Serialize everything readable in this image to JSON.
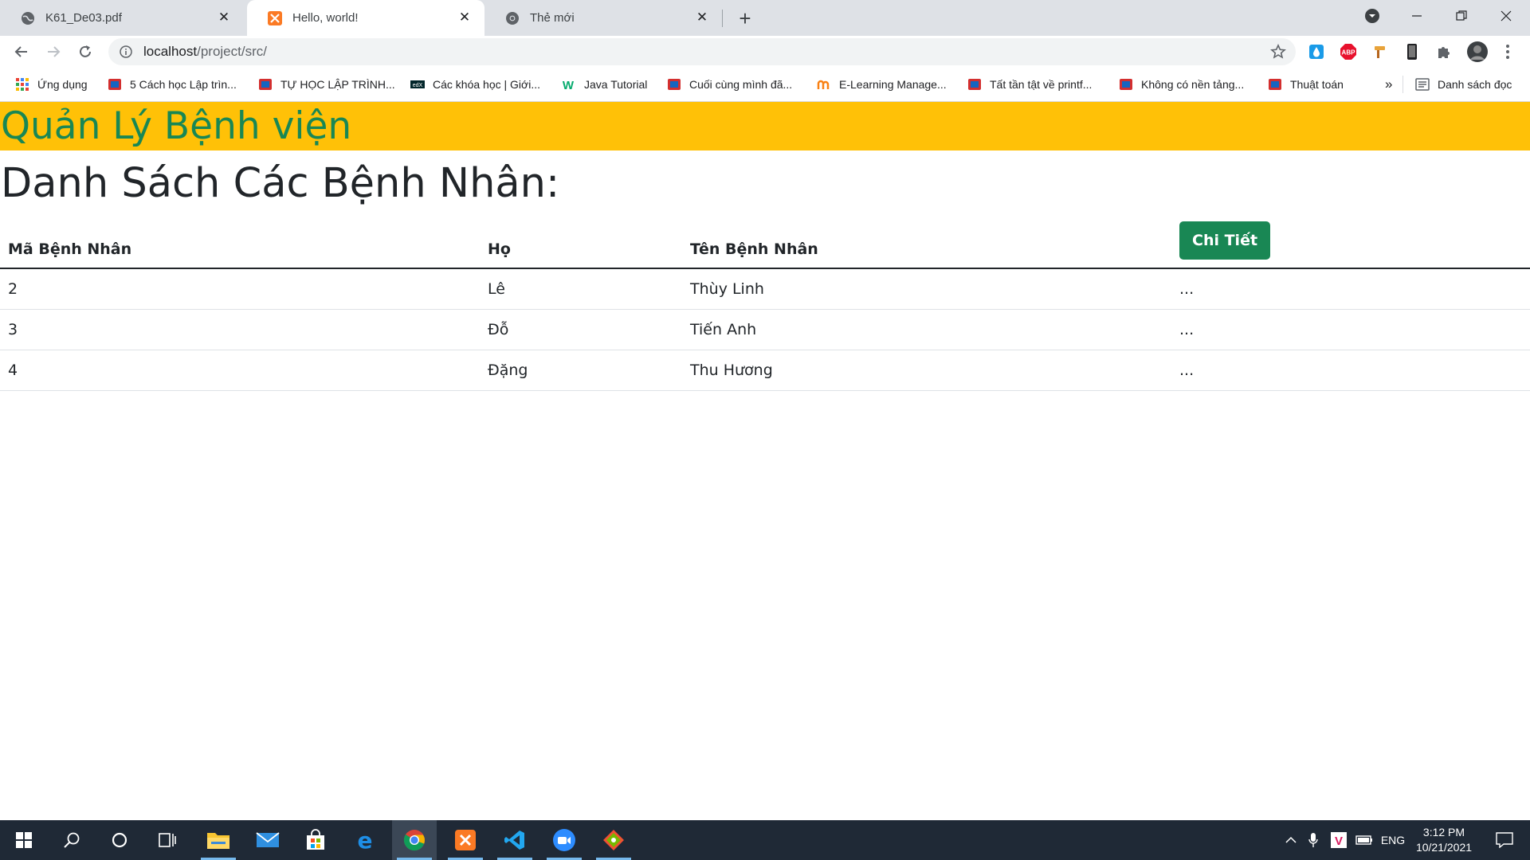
{
  "browser": {
    "tabs": [
      {
        "title": "K61_De03.pdf",
        "icon": "globe-icon"
      },
      {
        "title": "Hello, world!",
        "icon": "xampp-icon",
        "active": true
      },
      {
        "title": "Thẻ mới",
        "icon": "chrome-icon"
      }
    ],
    "url_host": "localhost",
    "url_path": "/project/src/",
    "bookmarks": [
      {
        "label": "Ứng dụng",
        "icon": "apps-grid-icon"
      },
      {
        "label": "5 Cách học Lập trìn...",
        "icon": "bookmark-site-icon"
      },
      {
        "label": "TỰ HỌC LẬP TRÌNH...",
        "icon": "bookmark-site-icon"
      },
      {
        "label": "Các khóa học | Giới...",
        "icon": "edx-icon"
      },
      {
        "label": "Java Tutorial",
        "icon": "w3-icon"
      },
      {
        "label": "Cuối cùng mình đã...",
        "icon": "bookmark-site-icon"
      },
      {
        "label": "E-Learning Manage...",
        "icon": "moodle-icon"
      },
      {
        "label": "Tất tần tật về printf...",
        "icon": "bookmark-site-icon"
      },
      {
        "label": "Không có nền tảng...",
        "icon": "bookmark-site-icon"
      },
      {
        "label": "Thuật toán",
        "icon": "bookmark-site-icon"
      }
    ],
    "bookmarks_overflow": "»",
    "reading_list": "Danh sách đọc"
  },
  "page": {
    "banner_title": "Quản Lý Bệnh viện",
    "list_title": "Danh Sách Các Bệnh Nhân:",
    "table": {
      "headers": [
        "Mã Bệnh Nhân",
        "Họ",
        "Tên Bệnh Nhân"
      ],
      "detail_button": "Chi Tiết",
      "rows": [
        {
          "id": "2",
          "last_name": "Lê",
          "first_name": "Thùy Linh",
          "detail": "..."
        },
        {
          "id": "3",
          "last_name": "Đỗ",
          "first_name": "Tiến Anh",
          "detail": "..."
        },
        {
          "id": "4",
          "last_name": "Đặng",
          "first_name": "Thu Hương",
          "detail": "..."
        }
      ]
    }
  },
  "taskbar": {
    "language": "ENG",
    "time": "3:12 PM",
    "date": "10/21/2021"
  },
  "colors": {
    "banner_bg": "#ffc107",
    "banner_text": "#198754",
    "button_bg": "#198754",
    "taskbar_bg": "#1f2936"
  }
}
